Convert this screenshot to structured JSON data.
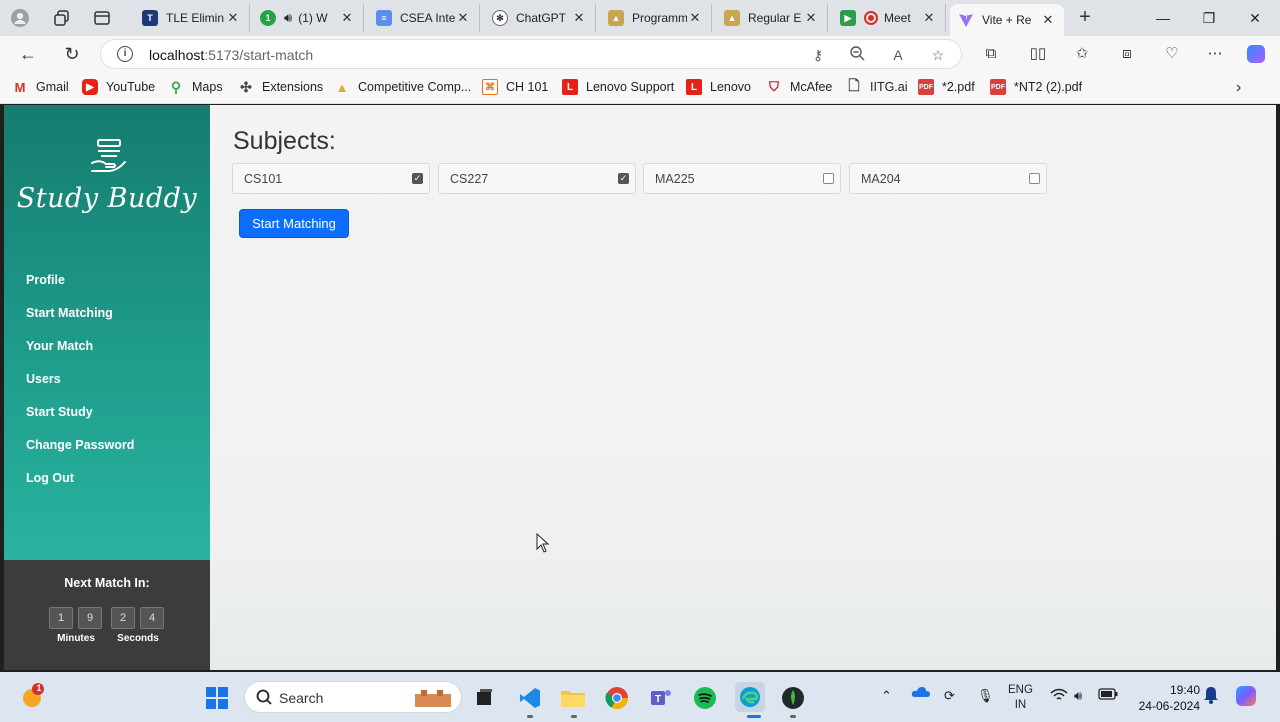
{
  "browser": {
    "tabs": [
      {
        "title": "TLE Elimin",
        "active": false
      },
      {
        "title": "(1) W",
        "active": false
      },
      {
        "title": "CSEA Inte",
        "active": false
      },
      {
        "title": "ChatGPT",
        "active": false
      },
      {
        "title": "Programm",
        "active": false
      },
      {
        "title": "Regular E",
        "active": false
      },
      {
        "title": "Meet",
        "active": false
      },
      {
        "title": "Vite + Re",
        "active": true
      }
    ],
    "close_glyph": "✕",
    "new_tab_glyph": "+",
    "address": {
      "host": "localhost",
      "path": ":5173/start-match"
    },
    "bookmarks": [
      "Gmail",
      "YouTube",
      "Maps",
      "Extensions",
      "Competitive Comp...",
      "CH 101",
      "Lenovo Support",
      "Lenovo",
      "McAfee",
      "IITG.ai",
      "*2.pdf",
      "*NT2 (2).pdf"
    ]
  },
  "app": {
    "brand": "Study Buddy",
    "nav": [
      "Profile",
      "Start Matching",
      "Your Match",
      "Users",
      "Start Study",
      "Change Password",
      "Log Out"
    ],
    "timer": {
      "title": "Next Match In:",
      "minutes_digits": [
        "1",
        "9"
      ],
      "seconds_digits": [
        "2",
        "4"
      ],
      "minutes_label": "Minutes",
      "seconds_label": "Seconds"
    },
    "subjects_title": "Subjects:",
    "subjects": [
      {
        "code": "CS101",
        "checked": true
      },
      {
        "code": "CS227",
        "checked": true
      },
      {
        "code": "MA225",
        "checked": false
      },
      {
        "code": "MA204",
        "checked": false
      }
    ],
    "start_button": "Start Matching",
    "accent_color": "#0d6efd",
    "sidebar_color": "#1f9c8c"
  },
  "taskbar": {
    "search_placeholder": "Search",
    "notification_count": "1",
    "lang": {
      "line1": "ENG",
      "line2": "IN"
    },
    "time": "19:40",
    "date": "24-06-2024"
  }
}
